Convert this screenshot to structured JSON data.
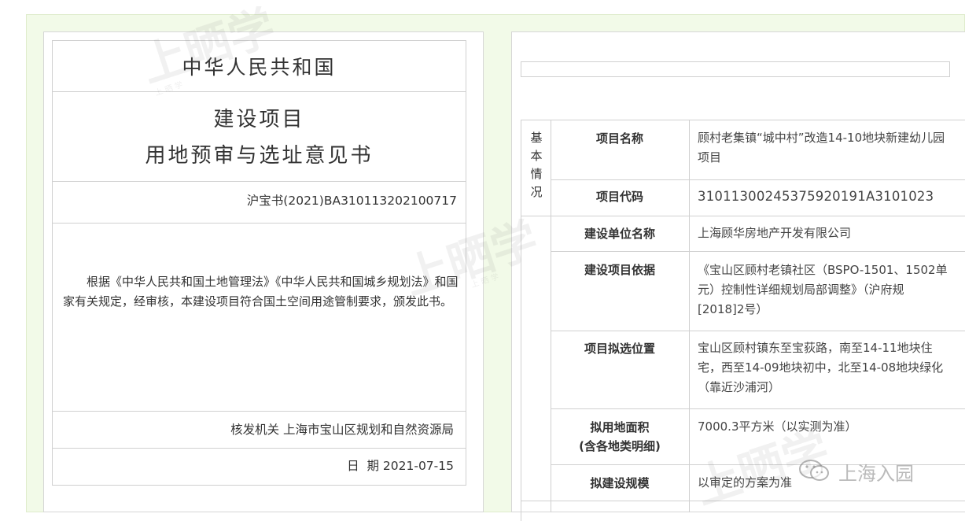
{
  "left": {
    "country": "中华人民共和国",
    "doc_title_line1": "建设项目",
    "doc_title_line2": "用地预审与选址意见书",
    "doc_number": "沪宝书(2021)BA310113202100717",
    "body": "根据《中华人民共和国土地管理法》《中华人民共和国城乡规划法》和国家有关规定，经审核，本建设项目符合国土空间用途管制要求，颁发此书。",
    "issuer": "核发机关 上海市宝山区规划和自然资源局",
    "date": "日  期 2021-07-15"
  },
  "right": {
    "side_label": [
      "基",
      "本",
      "情",
      "况"
    ],
    "rows": [
      {
        "label": "项目名称",
        "value": "顾村老集镇“城中村”改造14-10地块新建幼儿园项目"
      },
      {
        "label": "项目代码",
        "value": "31011300245375920191A3101023"
      },
      {
        "label": "建设单位名称",
        "value": "上海顾华房地产开发有限公司"
      },
      {
        "label": "建设项目依据",
        "value": "《宝山区顾村老镇社区（BSPO-1501、1502单元）控制性详细规划局部调整》（沪府规[2018]2号）"
      },
      {
        "label": "项目拟选位置",
        "value": "宝山区顾村镇东至宝荻路，南至14-11地块住宅，西至14-09地块初中，北至14-08地块绿化（靠近沙浦河）"
      },
      {
        "label": "拟用地面积",
        "label2": "(含各地类明细)",
        "value": "7000.3平方米（以实测为准）"
      },
      {
        "label": "拟建设规模",
        "value": "以审定的方案为准"
      }
    ]
  },
  "watermark": {
    "main": "上晒学",
    "small": "上 晒 学",
    "wechat": "上海入园"
  },
  "colors": {
    "frame_bg": "#f2fae8",
    "border": "#d0d0d0",
    "text": "#333333"
  }
}
